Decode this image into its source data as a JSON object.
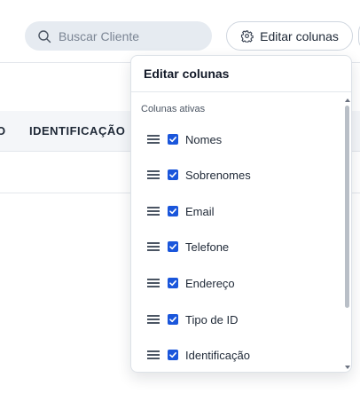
{
  "search": {
    "placeholder": "Buscar Cliente"
  },
  "toolbar": {
    "edit_columns_label": "Editar colunas"
  },
  "table": {
    "headers": [
      "O",
      "IDENTIFICAÇÃO"
    ]
  },
  "dropdown": {
    "title": "Editar colunas",
    "section_label": "Colunas ativas",
    "columns": [
      {
        "label": "Nomes",
        "checked": true
      },
      {
        "label": "Sobrenomes",
        "checked": true
      },
      {
        "label": "Email",
        "checked": true
      },
      {
        "label": "Telefone",
        "checked": true
      },
      {
        "label": "Endereço",
        "checked": true
      },
      {
        "label": "Tipo de ID",
        "checked": true
      },
      {
        "label": "Identificação",
        "checked": true
      }
    ]
  },
  "colors": {
    "accent": "#1a56db",
    "search_bg": "#e6ebf1",
    "header_strip": "#f4f6f9"
  }
}
